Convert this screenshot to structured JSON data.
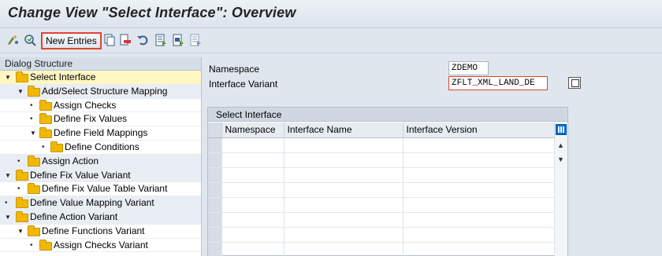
{
  "title": "Change View \"Select Interface\": Overview",
  "toolbar": {
    "new_entries_label": "New Entries",
    "icons": [
      "display-change-icon",
      "find-icon",
      "copy-icon",
      "delete-icon",
      "undo-icon",
      "select-all-icon",
      "select-block-icon",
      "deselect-all-icon"
    ]
  },
  "tree": {
    "header": "Dialog Structure",
    "items": [
      {
        "label": "Select Interface"
      },
      {
        "label": "Add/Select Structure Mapping"
      },
      {
        "label": "Assign Checks"
      },
      {
        "label": "Define Fix Values"
      },
      {
        "label": "Define Field Mappings"
      },
      {
        "label": "Define Conditions"
      },
      {
        "label": "Assign Action"
      },
      {
        "label": "Define Fix Value Variant"
      },
      {
        "label": "Define Fix Value Table Variant"
      },
      {
        "label": "Define Value Mapping Variant"
      },
      {
        "label": "Define Action Variant"
      },
      {
        "label": "Define Functions Variant"
      },
      {
        "label": "Assign Checks Variant"
      }
    ]
  },
  "fields": {
    "namespace_label": "Namespace",
    "namespace_value": "ZDEMO",
    "variant_label": "Interface Variant",
    "variant_value": "ZFLT_XML_LAND_DE"
  },
  "table": {
    "title": "Select Interface",
    "columns": [
      "Namespace",
      "Interface Name",
      "Interface Version"
    ]
  },
  "colors": {
    "highlight_border": "#e0442f",
    "selection_bg": "#fff7c2",
    "folder": "#f0b800"
  }
}
